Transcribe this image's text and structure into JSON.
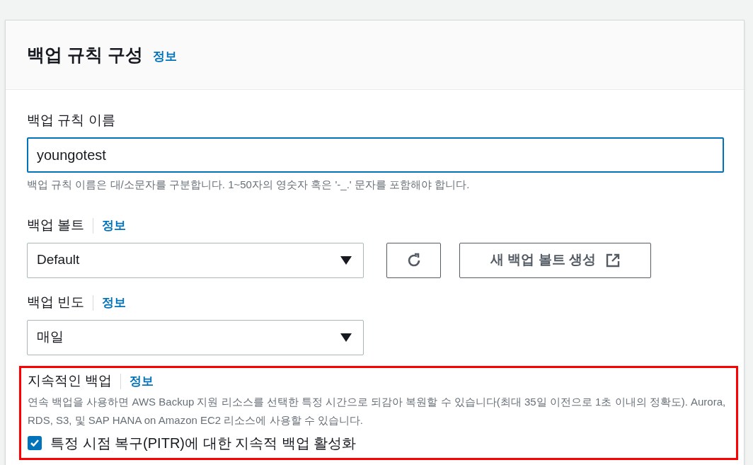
{
  "panel": {
    "title": "백업 규칙 구성",
    "info_link": "정보"
  },
  "rule_name": {
    "label": "백업 규칙 이름",
    "value": "youngotest",
    "focused": true,
    "hint": "백업 규칙 이름은 대/소문자를 구분합니다. 1~50자의 영숫자 혹은 '-_.' 문자를 포함해야 합니다."
  },
  "vault": {
    "label": "백업 볼트",
    "info_link": "정보",
    "value": "Default",
    "create_button": "새 백업 볼트 생성"
  },
  "frequency": {
    "label": "백업 빈도",
    "info_link": "정보",
    "value": "매일"
  },
  "continuous_backup": {
    "label": "지속적인 백업",
    "info_link": "정보",
    "highlighted": true,
    "description": "연속 백업을 사용하면 AWS Backup 지원 리소스를 선택한 특정 시간으로 되감아 복원할 수 있습니다(최대 35일 이전으로 1초 이내의 정확도). Aurora, RDS, S3, 및 SAP HANA on Amazon EC2 리소스에 사용할 수 있습니다.",
    "checkbox": {
      "label": "특정 시점 복구(PITR)에 대한 지속적 백업 활성화",
      "checked": true
    }
  }
}
